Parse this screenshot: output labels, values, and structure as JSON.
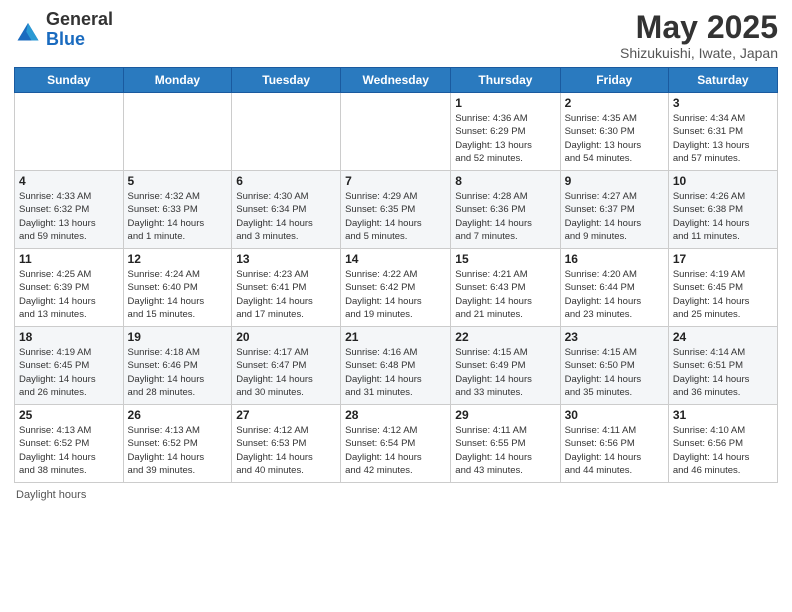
{
  "logo": {
    "general": "General",
    "blue": "Blue"
  },
  "title": "May 2025",
  "subtitle": "Shizukuishi, Iwate, Japan",
  "days_of_week": [
    "Sunday",
    "Monday",
    "Tuesday",
    "Wednesday",
    "Thursday",
    "Friday",
    "Saturday"
  ],
  "weeks": [
    [
      {
        "day": "",
        "info": ""
      },
      {
        "day": "",
        "info": ""
      },
      {
        "day": "",
        "info": ""
      },
      {
        "day": "",
        "info": ""
      },
      {
        "day": "1",
        "info": "Sunrise: 4:36 AM\nSunset: 6:29 PM\nDaylight: 13 hours\nand 52 minutes."
      },
      {
        "day": "2",
        "info": "Sunrise: 4:35 AM\nSunset: 6:30 PM\nDaylight: 13 hours\nand 54 minutes."
      },
      {
        "day": "3",
        "info": "Sunrise: 4:34 AM\nSunset: 6:31 PM\nDaylight: 13 hours\nand 57 minutes."
      }
    ],
    [
      {
        "day": "4",
        "info": "Sunrise: 4:33 AM\nSunset: 6:32 PM\nDaylight: 13 hours\nand 59 minutes."
      },
      {
        "day": "5",
        "info": "Sunrise: 4:32 AM\nSunset: 6:33 PM\nDaylight: 14 hours\nand 1 minute."
      },
      {
        "day": "6",
        "info": "Sunrise: 4:30 AM\nSunset: 6:34 PM\nDaylight: 14 hours\nand 3 minutes."
      },
      {
        "day": "7",
        "info": "Sunrise: 4:29 AM\nSunset: 6:35 PM\nDaylight: 14 hours\nand 5 minutes."
      },
      {
        "day": "8",
        "info": "Sunrise: 4:28 AM\nSunset: 6:36 PM\nDaylight: 14 hours\nand 7 minutes."
      },
      {
        "day": "9",
        "info": "Sunrise: 4:27 AM\nSunset: 6:37 PM\nDaylight: 14 hours\nand 9 minutes."
      },
      {
        "day": "10",
        "info": "Sunrise: 4:26 AM\nSunset: 6:38 PM\nDaylight: 14 hours\nand 11 minutes."
      }
    ],
    [
      {
        "day": "11",
        "info": "Sunrise: 4:25 AM\nSunset: 6:39 PM\nDaylight: 14 hours\nand 13 minutes."
      },
      {
        "day": "12",
        "info": "Sunrise: 4:24 AM\nSunset: 6:40 PM\nDaylight: 14 hours\nand 15 minutes."
      },
      {
        "day": "13",
        "info": "Sunrise: 4:23 AM\nSunset: 6:41 PM\nDaylight: 14 hours\nand 17 minutes."
      },
      {
        "day": "14",
        "info": "Sunrise: 4:22 AM\nSunset: 6:42 PM\nDaylight: 14 hours\nand 19 minutes."
      },
      {
        "day": "15",
        "info": "Sunrise: 4:21 AM\nSunset: 6:43 PM\nDaylight: 14 hours\nand 21 minutes."
      },
      {
        "day": "16",
        "info": "Sunrise: 4:20 AM\nSunset: 6:44 PM\nDaylight: 14 hours\nand 23 minutes."
      },
      {
        "day": "17",
        "info": "Sunrise: 4:19 AM\nSunset: 6:45 PM\nDaylight: 14 hours\nand 25 minutes."
      }
    ],
    [
      {
        "day": "18",
        "info": "Sunrise: 4:19 AM\nSunset: 6:45 PM\nDaylight: 14 hours\nand 26 minutes."
      },
      {
        "day": "19",
        "info": "Sunrise: 4:18 AM\nSunset: 6:46 PM\nDaylight: 14 hours\nand 28 minutes."
      },
      {
        "day": "20",
        "info": "Sunrise: 4:17 AM\nSunset: 6:47 PM\nDaylight: 14 hours\nand 30 minutes."
      },
      {
        "day": "21",
        "info": "Sunrise: 4:16 AM\nSunset: 6:48 PM\nDaylight: 14 hours\nand 31 minutes."
      },
      {
        "day": "22",
        "info": "Sunrise: 4:15 AM\nSunset: 6:49 PM\nDaylight: 14 hours\nand 33 minutes."
      },
      {
        "day": "23",
        "info": "Sunrise: 4:15 AM\nSunset: 6:50 PM\nDaylight: 14 hours\nand 35 minutes."
      },
      {
        "day": "24",
        "info": "Sunrise: 4:14 AM\nSunset: 6:51 PM\nDaylight: 14 hours\nand 36 minutes."
      }
    ],
    [
      {
        "day": "25",
        "info": "Sunrise: 4:13 AM\nSunset: 6:52 PM\nDaylight: 14 hours\nand 38 minutes."
      },
      {
        "day": "26",
        "info": "Sunrise: 4:13 AM\nSunset: 6:52 PM\nDaylight: 14 hours\nand 39 minutes."
      },
      {
        "day": "27",
        "info": "Sunrise: 4:12 AM\nSunset: 6:53 PM\nDaylight: 14 hours\nand 40 minutes."
      },
      {
        "day": "28",
        "info": "Sunrise: 4:12 AM\nSunset: 6:54 PM\nDaylight: 14 hours\nand 42 minutes."
      },
      {
        "day": "29",
        "info": "Sunrise: 4:11 AM\nSunset: 6:55 PM\nDaylight: 14 hours\nand 43 minutes."
      },
      {
        "day": "30",
        "info": "Sunrise: 4:11 AM\nSunset: 6:56 PM\nDaylight: 14 hours\nand 44 minutes."
      },
      {
        "day": "31",
        "info": "Sunrise: 4:10 AM\nSunset: 6:56 PM\nDaylight: 14 hours\nand 46 minutes."
      }
    ]
  ],
  "footer": "Daylight hours"
}
